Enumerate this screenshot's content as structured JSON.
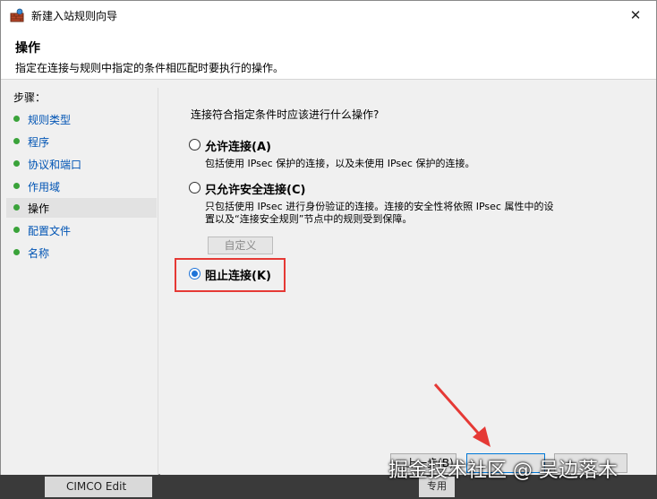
{
  "window": {
    "title": "新建入站规则向导",
    "close_symbol": "✕"
  },
  "header": {
    "title": "操作",
    "description": "指定在连接与规则中指定的条件相匹配时要执行的操作。"
  },
  "steps": {
    "title": "步骤：",
    "items": [
      {
        "label": "规则类型",
        "current": false
      },
      {
        "label": "程序",
        "current": false
      },
      {
        "label": "协议和端口",
        "current": false
      },
      {
        "label": "作用域",
        "current": false
      },
      {
        "label": "操作",
        "current": true
      },
      {
        "label": "配置文件",
        "current": false
      },
      {
        "label": "名称",
        "current": false
      }
    ]
  },
  "content": {
    "question": "连接符合指定条件时应该进行什么操作?",
    "options": [
      {
        "label": "允许连接(A)",
        "description": [
          "包括使用 IPsec 保护的连接，以及未使用 IPsec 保护的连接。"
        ],
        "checked": false
      },
      {
        "label": "只允许安全连接(C)",
        "description": [
          "只包括使用 IPsec 进行身份验证的连接。连接的安全性将依照 IPsec 属性中的设",
          "置以及“连接安全规则”节点中的规则受到保障。"
        ],
        "checked": false
      },
      {
        "label": "阻止连接(K)",
        "description": [],
        "checked": true
      }
    ],
    "customize_label": "自定义"
  },
  "buttons": {
    "prev": "< 上一步(B)",
    "next": "",
    "cancel": ""
  },
  "taskbar": {
    "item1": "CIMCO Edit",
    "item2": "专用"
  },
  "watermark": "掘金技术社区 @ 吴边落木",
  "colors": {
    "accent": "#1e73d8",
    "step_dot": "#3aa33a",
    "step_link": "#0054b4",
    "annotation_red": "#e53935"
  }
}
